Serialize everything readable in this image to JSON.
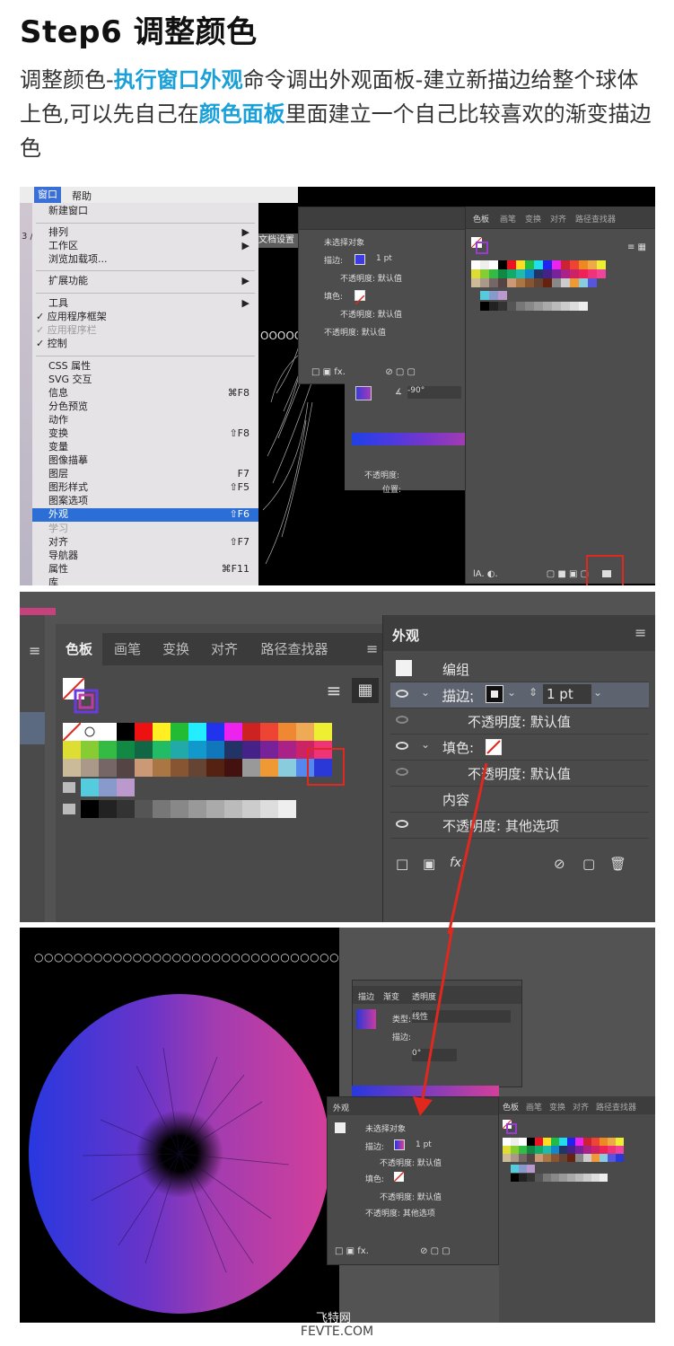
{
  "heading": "Step6 调整颜色",
  "intro": {
    "part1": "调整颜色-",
    "hl1": "执行窗口外观",
    "part2": "命令调出外观面板-建立新描边给整个球体上色,可以先自己在",
    "hl2": "颜色面板",
    "part3": "里面建立一个自己比较喜欢的渐变描边色"
  },
  "colors": {
    "highlight": "#1aa0d8",
    "menu_highlight": "#2b6fd6",
    "red_marker": "#e0281e"
  },
  "screenshot1": {
    "menubar": {
      "window": "窗口",
      "help": "帮助"
    },
    "tab_fragment": "3 /",
    "doc_settings": "文档设置",
    "menu_items": [
      {
        "label": "新建窗口",
        "shortcut": ""
      },
      {
        "label": "排列",
        "shortcut": "▶"
      },
      {
        "label": "工作区",
        "shortcut": "▶"
      },
      {
        "label": "浏览加载项...",
        "shortcut": ""
      },
      {
        "label": "扩展功能",
        "shortcut": "▶"
      },
      {
        "label": "工具",
        "shortcut": "▶"
      },
      {
        "label": "✓ 应用程序框架",
        "shortcut": ""
      },
      {
        "label": "✓ 应用程序栏",
        "shortcut": ""
      },
      {
        "label": "✓ 控制",
        "shortcut": ""
      },
      {
        "label": "CSS 属性",
        "shortcut": ""
      },
      {
        "label": "SVG 交互",
        "shortcut": ""
      },
      {
        "label": "信息",
        "shortcut": "⌘F8"
      },
      {
        "label": "分色预览",
        "shortcut": ""
      },
      {
        "label": "动作",
        "shortcut": ""
      },
      {
        "label": "变换",
        "shortcut": "⇧F8"
      },
      {
        "label": "变量",
        "shortcut": ""
      },
      {
        "label": "图像描摹",
        "shortcut": ""
      },
      {
        "label": "图层",
        "shortcut": "F7"
      },
      {
        "label": "图形样式",
        "shortcut": "⇧F5"
      },
      {
        "label": "图案选项",
        "shortcut": ""
      },
      {
        "label": "外观",
        "shortcut": "⇧F6"
      },
      {
        "label": "学习",
        "shortcut": ""
      },
      {
        "label": "对齐",
        "shortcut": "⇧F7"
      },
      {
        "label": "导航器",
        "shortcut": ""
      },
      {
        "label": "属性",
        "shortcut": "⌘F11"
      },
      {
        "label": "库",
        "shortcut": ""
      }
    ],
    "appearance": {
      "header": "未选择对象",
      "stroke": "描边:",
      "stroke_value": "1 pt",
      "opacity_default": "不透明度: 默认值",
      "fill": "填色:",
      "opacity_bottom": "不透明度: 默认值"
    },
    "gradient": {
      "angle": "-90°",
      "opacity_label": "不透明度:",
      "position_label": "位置:"
    },
    "swatch_tabs": [
      "色板",
      "画笔",
      "变换",
      "对齐",
      "路径查找器"
    ]
  },
  "screenshot2": {
    "swatch_tabs": [
      "色板",
      "画笔",
      "变换",
      "对齐",
      "路径查找器"
    ],
    "appearance_title": "外观",
    "rows": {
      "group": "编组",
      "stroke": "描边:",
      "stroke_value": "1 pt",
      "opacity1": "不透明度: 默认值",
      "fill": "填色:",
      "opacity2": "不透明度: 默认值",
      "contents": "内容",
      "opacity3": "不透明度: 其他选项"
    }
  },
  "screenshot3": {
    "grad_tabs": [
      "描边",
      "渐变",
      "透明度"
    ],
    "grad_type_label": "类型:",
    "grad_type": "线性",
    "grad_stroke_label": "描边:",
    "grad_angle": "0°",
    "appearance_title": "外观",
    "appearance": {
      "header": "未选择对象",
      "stroke": "描边:",
      "stroke_value": "1 pt",
      "opacity1": "不透明度: 默认值",
      "fill": "填色:",
      "opacity2": "不透明度: 默认值",
      "opacity3": "不透明度: 其他选项"
    },
    "swatch_tabs": [
      "色板",
      "画笔",
      "变换",
      "对齐",
      "路径查找器"
    ],
    "watermark": "飞特网"
  },
  "footer": "FEVTE.COM"
}
